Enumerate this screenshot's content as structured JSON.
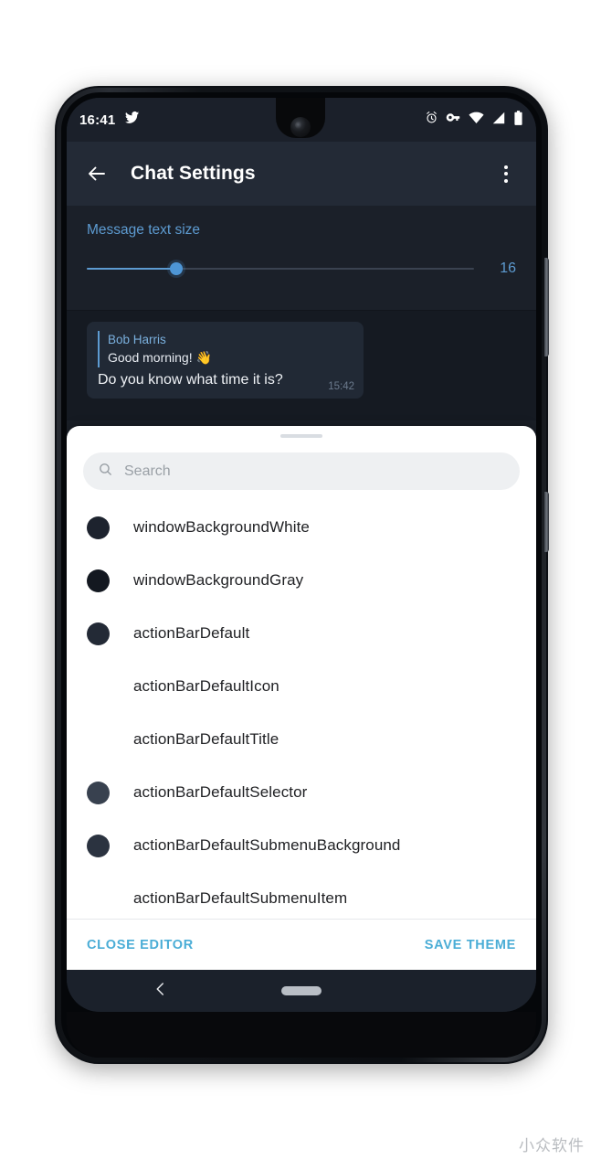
{
  "status_bar": {
    "time": "16:41",
    "app_icon": "twitter-bird-icon",
    "icons": [
      "alarm-icon",
      "vpn-key-icon",
      "wifi-icon",
      "cellular-signal-icon",
      "battery-icon"
    ]
  },
  "app_bar": {
    "back_icon": "arrow-back-icon",
    "title": "Chat Settings",
    "overflow_icon": "more-vert-icon"
  },
  "text_size_section": {
    "label": "Message text size",
    "value": "16",
    "slider": {
      "min": 12,
      "max": 30,
      "current": 16,
      "percent": 23
    },
    "accent_color": "#5d9bd1"
  },
  "chat_preview": {
    "reply": {
      "name": "Bob Harris",
      "text": "Good morning! 👋"
    },
    "message": "Do you know what time it is?",
    "time": "15:42"
  },
  "bottom_sheet": {
    "search": {
      "placeholder": "Search",
      "value": "",
      "icon": "search-icon"
    },
    "items": [
      {
        "label": "windowBackgroundWhite",
        "swatch": "#1d232e",
        "has_swatch": true
      },
      {
        "label": "windowBackgroundGray",
        "swatch": "#131820",
        "has_swatch": true
      },
      {
        "label": "actionBarDefault",
        "swatch": "#232a36",
        "has_swatch": true
      },
      {
        "label": "actionBarDefaultIcon",
        "swatch": "",
        "has_swatch": false
      },
      {
        "label": "actionBarDefaultTitle",
        "swatch": "",
        "has_swatch": false
      },
      {
        "label": "actionBarDefaultSelector",
        "swatch": "#38414f",
        "has_swatch": true
      },
      {
        "label": "actionBarDefaultSubmenuBackground",
        "swatch": "#2b3340",
        "has_swatch": true
      },
      {
        "label": "actionBarDefaultSubmenuItem",
        "swatch": "",
        "has_swatch": false
      }
    ],
    "actions": {
      "close_label": "CLOSE EDITOR",
      "save_label": "SAVE THEME",
      "color": "#4aadd6"
    }
  },
  "nav_bar": {
    "back_icon": "nav-back-chevron-icon",
    "home_pill": "nav-home-pill"
  },
  "watermark": "小众软件"
}
